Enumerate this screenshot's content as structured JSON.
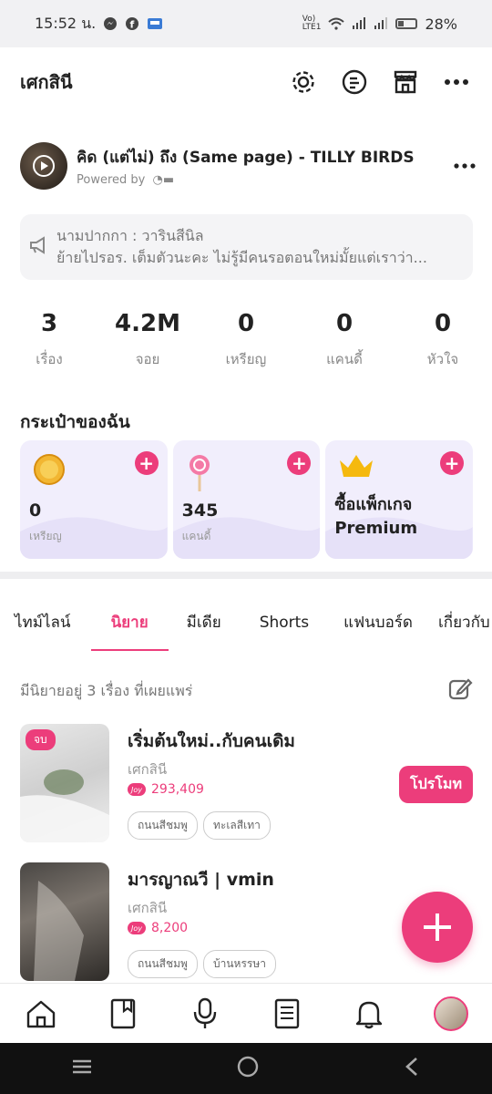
{
  "status_bar": {
    "time": "15:52 น.",
    "battery": "28%"
  },
  "header": {
    "title": "เศกสินี"
  },
  "music": {
    "title": "คิด (แต่ไม่) ถึง (Same page) - TILLY BIRDS",
    "powered_by": "Powered by"
  },
  "announcement": {
    "line1": "นามปากกา : วารินสีนิล",
    "line2": "ย้ายไปรอร. เต็มตัวนะคะ ไม่รู้มีคนรอตอนใหม่มั้ยแต่เราว่า..."
  },
  "stats": [
    {
      "value": "3",
      "label": "เรื่อง"
    },
    {
      "value": "4.2M",
      "label": "จอย"
    },
    {
      "value": "0",
      "label": "เหรียญ"
    },
    {
      "value": "0",
      "label": "แคนดี้"
    },
    {
      "value": "0",
      "label": "หัวใจ"
    }
  ],
  "wallet": {
    "title": "กระเป๋าของฉัน",
    "coins": {
      "value": "0",
      "label": "เหรียญ"
    },
    "candy": {
      "value": "345",
      "label": "แคนดี้"
    },
    "premium": {
      "line1": "ซื้อแพ็กเกจ",
      "line2": "Premium"
    }
  },
  "tabs": [
    "ไทม์ไลน์",
    "นิยาย",
    "มีเดีย",
    "Shorts",
    "แฟนบอร์ด",
    "เกี่ยวกับ"
  ],
  "active_tab": 1,
  "novels_count_text": "มีนิยายอยู่ 3 เรื่อง ที่เผยแพร่",
  "novels": [
    {
      "badge": "จบ",
      "title": "เริ่มต้นใหม่..กับคนเดิม",
      "author": "เศกสินี",
      "joy": "293,409",
      "tags": [
        "ถนนสีชมพู",
        "ทะเลสีเทา"
      ],
      "promote": "โปรโมท"
    },
    {
      "title": "มารญาณวี | vmin",
      "author": "เศกสินี",
      "joy": "8,200",
      "tags": [
        "ถนนสีชมพู",
        "บ้านหรรษา"
      ]
    }
  ],
  "colors": {
    "accent": "#ec3d7b",
    "wallet_card": "#f1eefc"
  }
}
